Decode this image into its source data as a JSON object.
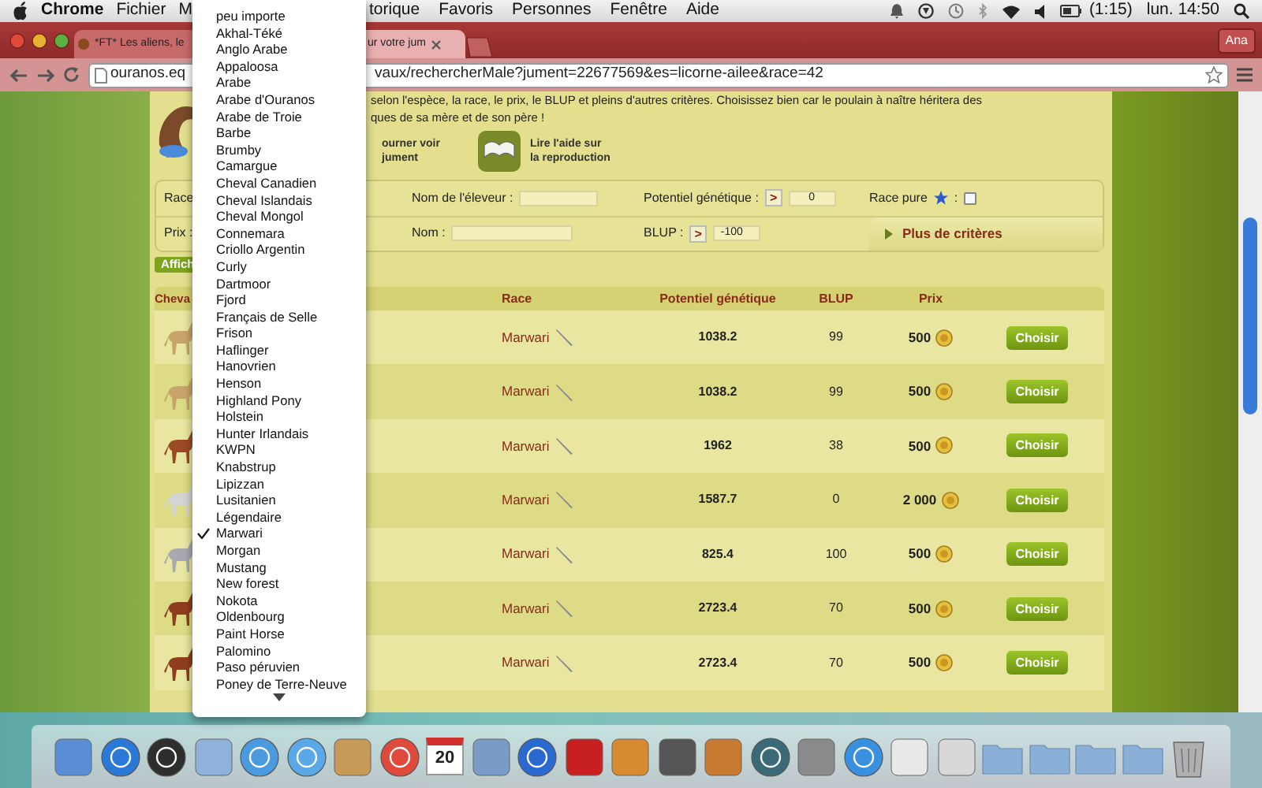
{
  "menu_bar": {
    "app_name": "Chrome",
    "menus": [
      "Fichier",
      "M"
    ],
    "menus_after": [
      "torique",
      "Favoris",
      "Personnes",
      "Fenêtre",
      "Aide"
    ],
    "battery_time": "(1:15)",
    "clock": "lun. 14:50"
  },
  "browser": {
    "tabs": [
      {
        "title": "*FT* Les aliens, le",
        "selected": false
      },
      {
        "title": "ur votre jum",
        "selected": true
      }
    ],
    "profile": "Ana",
    "url_start": "ouranos.eq",
    "url_end": "vaux/rechercherMale?jument=22677569&es=licorne-ailee&race=42"
  },
  "page": {
    "intro_lines": [
      "selon l'espèce, la race, le prix, le BLUP et pleins d'autres critères. Choisissez bien car le poulain à naître héritera des",
      "ques de sa mère et de son père !"
    ],
    "actions": [
      {
        "kind": "back",
        "label": "ourner voir\njument"
      },
      {
        "kind": "book",
        "label": "Lire l'aide sur\nla reproduction"
      }
    ],
    "filters": {
      "race_label": "Race",
      "breeder_label": "Nom de l'éleveur :",
      "potential": {
        "label": "Potentiel génétique :",
        "operator": ">",
        "value": "0"
      },
      "pure": {
        "label": "Race pure",
        "suffix": ":",
        "checked": false
      },
      "price_label": "Prix :",
      "name_label": "Nom :",
      "blup": {
        "label": "BLUP :",
        "operator": ">",
        "value": "-100"
      },
      "more": "Plus de critères"
    },
    "show_button": "Affich",
    "table": {
      "columns": [
        "Cheva",
        "Race",
        "Potentiel génétique",
        "BLUP",
        "Prix"
      ],
      "rows": [
        {
          "color": "#c8a46a",
          "race": "Marwari",
          "potential": "1038.2",
          "blup": "99",
          "price": "500",
          "action": "Choisir"
        },
        {
          "color": "#c8a46a",
          "race": "Marwari",
          "potential": "1038.2",
          "blup": "99",
          "price": "500",
          "action": "Choisir"
        },
        {
          "color": "#9a4a24",
          "race": "Marwari",
          "potential": "1962",
          "blup": "38",
          "price": "500",
          "action": "Choisir"
        },
        {
          "color": "#d4d4d4",
          "race": "Marwari",
          "potential": "1587.7",
          "blup": "0",
          "price": "2 000",
          "action": "Choisir"
        },
        {
          "color": "#a8a8b0",
          "race": "Marwari",
          "potential": "825.4",
          "blup": "100",
          "price": "500",
          "action": "Choisir"
        },
        {
          "color": "#8e3e1e",
          "race": "Marwari",
          "potential": "2723.4",
          "blup": "70",
          "price": "500",
          "action": "Choisir"
        },
        {
          "color": "#8e3e1e",
          "race": "Marwari",
          "potential": "2723.4",
          "blup": "70",
          "price": "500",
          "action": "Choisir"
        }
      ]
    }
  },
  "race_dropdown": {
    "options": [
      {
        "label": "peu importe",
        "selected": false
      },
      {
        "label": "Akhal-Téké",
        "selected": false
      },
      {
        "label": "Anglo Arabe",
        "selected": false
      },
      {
        "label": "Appaloosa",
        "selected": false
      },
      {
        "label": "Arabe",
        "selected": false
      },
      {
        "label": "Arabe d'Ouranos",
        "selected": false
      },
      {
        "label": "Arabe de Troie",
        "selected": false
      },
      {
        "label": "Barbe",
        "selected": false
      },
      {
        "label": "Brumby",
        "selected": false
      },
      {
        "label": "Camargue",
        "selected": false
      },
      {
        "label": "Cheval Canadien",
        "selected": false
      },
      {
        "label": "Cheval Islandais",
        "selected": false
      },
      {
        "label": "Cheval Mongol",
        "selected": false
      },
      {
        "label": "Connemara",
        "selected": false
      },
      {
        "label": "Criollo Argentin",
        "selected": false
      },
      {
        "label": "Curly",
        "selected": false
      },
      {
        "label": "Dartmoor",
        "selected": false
      },
      {
        "label": "Fjord",
        "selected": false
      },
      {
        "label": "Français de Selle",
        "selected": false
      },
      {
        "label": "Frison",
        "selected": false
      },
      {
        "label": "Haflinger",
        "selected": false
      },
      {
        "label": "Hanovrien",
        "selected": false
      },
      {
        "label": "Henson",
        "selected": false
      },
      {
        "label": "Highland Pony",
        "selected": false
      },
      {
        "label": "Holstein",
        "selected": false
      },
      {
        "label": "Hunter Irlandais",
        "selected": false
      },
      {
        "label": "KWPN",
        "selected": false
      },
      {
        "label": "Knabstrup",
        "selected": false
      },
      {
        "label": "Lipizzan",
        "selected": false
      },
      {
        "label": "Lusitanien",
        "selected": false
      },
      {
        "label": "Légendaire",
        "selected": false
      },
      {
        "label": "Marwari",
        "selected": true
      },
      {
        "label": "Morgan",
        "selected": false
      },
      {
        "label": "Mustang",
        "selected": false
      },
      {
        "label": "New forest",
        "selected": false
      },
      {
        "label": "Nokota",
        "selected": false
      },
      {
        "label": "Oldenbourg",
        "selected": false
      },
      {
        "label": "Paint Horse",
        "selected": false
      },
      {
        "label": "Palomino",
        "selected": false
      },
      {
        "label": "Paso péruvien",
        "selected": false
      },
      {
        "label": "Poney de Terre-Neuve",
        "selected": false
      }
    ]
  },
  "dock": {
    "items": [
      {
        "kind": "tile",
        "color": "#5a8fd8"
      },
      {
        "kind": "disc",
        "color": "#2a78d8"
      },
      {
        "kind": "disc",
        "color": "#2e2e2e"
      },
      {
        "kind": "tile",
        "color": "#8fb2dc"
      },
      {
        "kind": "disc",
        "color": "#4a9ae0"
      },
      {
        "kind": "disc",
        "color": "#5aa8e8"
      },
      {
        "kind": "tile",
        "color": "#c89a58"
      },
      {
        "kind": "disc",
        "color": "#e04a3a"
      },
      {
        "kind": "calendar",
        "label": "20"
      },
      {
        "kind": "tile",
        "color": "#7a9ac8"
      },
      {
        "kind": "disc",
        "color": "#2a6ad0"
      },
      {
        "kind": "tile",
        "color": "#c82020"
      },
      {
        "kind": "tile",
        "color": "#d88a30"
      },
      {
        "kind": "tile",
        "color": "#555555"
      },
      {
        "kind": "tile",
        "color": "#c87a30"
      },
      {
        "kind": "disc",
        "color": "#3a6a78"
      },
      {
        "kind": "tile",
        "color": "#8a8a8a"
      },
      {
        "kind": "disc",
        "color": "#3a90e0"
      },
      {
        "kind": "tile",
        "color": "#e8e8e8"
      },
      {
        "kind": "tile",
        "color": "#d8d8d8"
      },
      {
        "kind": "folder",
        "color": "#8ab0d8"
      },
      {
        "kind": "folder",
        "color": "#8ab0d8"
      },
      {
        "kind": "folder",
        "color": "#8ab0d8"
      },
      {
        "kind": "folder",
        "color": "#8ab0d8"
      },
      {
        "kind": "trash",
        "color": "#b0b0b0"
      }
    ]
  }
}
